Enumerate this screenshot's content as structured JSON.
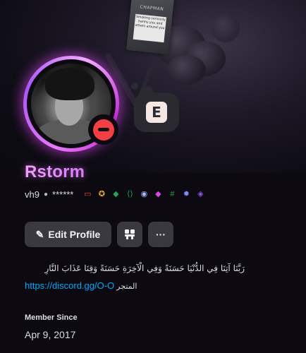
{
  "banner": {
    "pack_brand": "CHAPMAN",
    "pack_warning": "Smoking seriously harms you and others around you"
  },
  "status_bubble": {
    "emoji_letter": "E"
  },
  "profile": {
    "display_name": "Rstorm",
    "username": "vh9",
    "pronouns": "******",
    "accent_color": "#e879f9",
    "status": "do-not-disturb"
  },
  "badges": [
    {
      "name": "active-developer-monitor-icon",
      "color": "#ed4245",
      "glyph": "▭"
    },
    {
      "name": "hypesquad-bravery-icon",
      "color": "#f0b232",
      "glyph": "✪"
    },
    {
      "name": "early-supporter-diamond-icon",
      "color": "#23a559",
      "glyph": "◆"
    },
    {
      "name": "code-badge-icon",
      "color": "#23a559",
      "glyph": "⟨⟩"
    },
    {
      "name": "quest-badge-icon",
      "color": "#a5b4fc",
      "glyph": "◉"
    },
    {
      "name": "nitro-gem-icon",
      "color": "#d946ef",
      "glyph": "◆"
    },
    {
      "name": "hashtag-badge-icon",
      "color": "#23a559",
      "glyph": "#"
    },
    {
      "name": "server-boost-icon",
      "color": "#818cf8",
      "glyph": "✹"
    },
    {
      "name": "nitro-crest-icon",
      "color": "#8b5cf6",
      "glyph": "◈"
    }
  ],
  "actions": {
    "edit_profile_label": "Edit Profile",
    "more_label": "···"
  },
  "bio": {
    "arabic_line": "رَبَّنَا آتِنَا فِي الدُّنْيَا حَسَنَةً وَفِي الْآخِرَةِ حَسَنَةً وَقِنَا عَذَابَ النَّارِ",
    "link": "https://discord.gg/O-O",
    "after_link": "المتجر"
  },
  "member_since": {
    "title": "Member Since",
    "date": "Apr 9, 2017"
  }
}
